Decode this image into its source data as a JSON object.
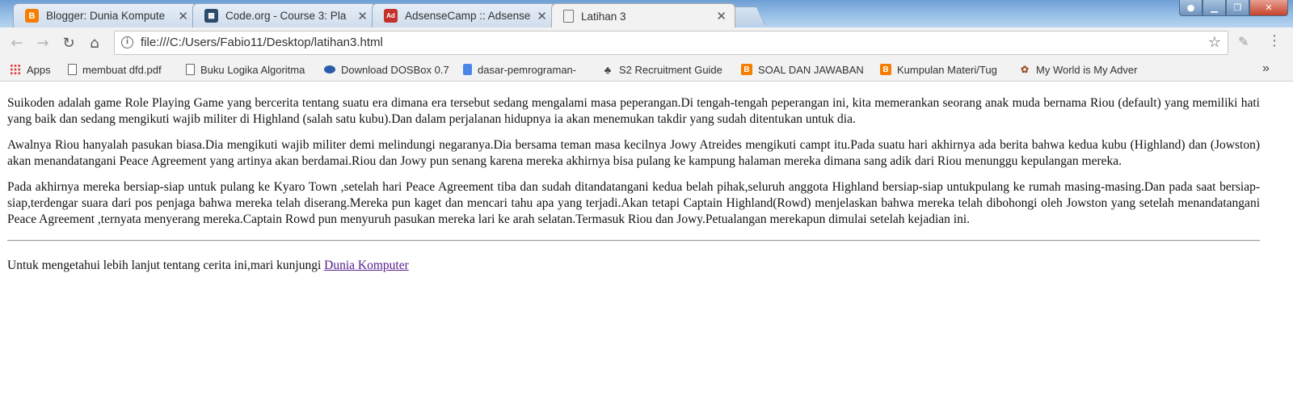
{
  "tabs": [
    {
      "title": "Blogger: Dunia Kompute",
      "icon": "blogger-icon",
      "active": false
    },
    {
      "title": "Code.org - Course 3: Pla",
      "icon": "code-org-icon",
      "active": false
    },
    {
      "title": "AdsenseCamp :: Adsense",
      "icon": "adsense-icon",
      "active": false
    },
    {
      "title": "Latihan 3",
      "icon": "page-icon",
      "active": true
    }
  ],
  "toolbar": {
    "url": "file:///C:/Users/Fabio11/Desktop/latihan3.html"
  },
  "bookmarks": [
    {
      "label": "Apps",
      "icon": "apps-icon"
    },
    {
      "label": "membuat dfd.pdf",
      "icon": "page-icon"
    },
    {
      "label": "Buku Logika Algoritma",
      "icon": "page-icon"
    },
    {
      "label": "Download DOSBox 0.7",
      "icon": "dosbox-icon"
    },
    {
      "label": "dasar-pemrograman-",
      "icon": "google-docs-icon"
    },
    {
      "label": "S2 Recruitment Guide",
      "icon": "s2-icon"
    },
    {
      "label": "SOAL DAN JAWABAN",
      "icon": "blogger-icon"
    },
    {
      "label": "Kumpulan Materi/Tug",
      "icon": "blogger-icon"
    },
    {
      "label": "My World is My Adver",
      "icon": "world-icon"
    }
  ],
  "content": {
    "paragraphs": [
      "Suikoden adalah game Role Playing Game yang bercerita tentang suatu era dimana era tersebut sedang mengalami masa peperangan.Di tengah-tengah peperangan ini, kita memerankan seorang anak muda bernama Riou (default) yang memiliki hati yang baik dan sedang mengikuti wajib militer di Highland (salah satu kubu).Dan dalam perjalanan hidupnya ia akan menemukan takdir yang sudah ditentukan untuk dia.",
      "Awalnya Riou hanyalah pasukan biasa.Dia mengikuti wajib militer demi melindungi negaranya.Dia bersama teman masa kecilnya Jowy Atreides mengikuti campt itu.Pada suatu hari akhirnya ada berita bahwa kedua kubu (Highland) dan (Jowston) akan menandatangani Peace Agreement yang artinya akan berdamai.Riou dan Jowy pun senang karena mereka akhirnya bisa pulang ke kampung halaman mereka dimana sang adik dari Riou menunggu kepulangan mereka.",
      "Pada akhirnya mereka bersiap-siap untuk pulang ke Kyaro Town ,setelah hari Peace Agreement tiba dan sudah ditandatangani kedua belah pihak,seluruh anggota Highland bersiap-siap untukpulang ke rumah masing-masing.Dan pada saat bersiap-siap,terdengar suara dari pos penjaga bahwa mereka telah diserang.Mereka pun kaget dan mencari tahu apa yang terjadi.Akan tetapi Captain Highland(Rowd) menjelaskan bahwa mereka telah dibohongi oleh Jowston yang setelah menandatangani Peace Agreement ,ternyata menyerang mereka.Captain Rowd pun menyuruh pasukan mereka lari ke arah selatan.Termasuk Riou dan Jowy.Petualangan merekapun dimulai setelah kejadian ini."
    ],
    "footer_text": "Untuk mengetahui lebih lanjut tentang cerita ini,mari kunjungi ",
    "footer_link": "Dunia Komputer"
  },
  "colors": {
    "link": "#551a8b",
    "blogger": "#f57d00"
  }
}
